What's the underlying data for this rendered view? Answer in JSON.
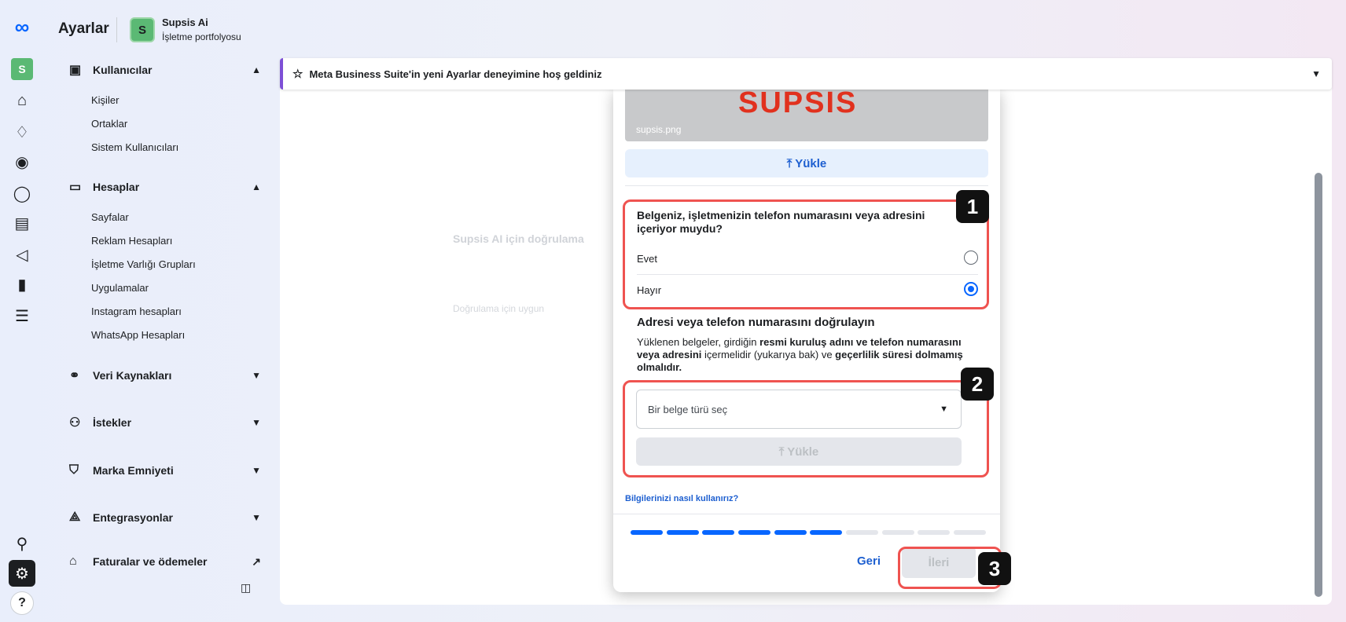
{
  "app": {
    "settings_title": "Ayarlar",
    "business_initial": "S",
    "business_name": "Supsis Ai",
    "business_type": "İşletme portfolyosu"
  },
  "rail": {
    "logo_glyph": "∞",
    "avatar_initial": "S",
    "help_glyph": "?"
  },
  "sidebar": {
    "users": {
      "label": "Kullanıcılar",
      "items": [
        "Kişiler",
        "Ortaklar",
        "Sistem Kullanıcıları"
      ]
    },
    "accounts": {
      "label": "Hesaplar",
      "items": [
        "Sayfalar",
        "Reklam Hesapları",
        "İşletme Varlığı Grupları",
        "Uygulamalar",
        "Instagram hesapları",
        "WhatsApp Hesapları"
      ]
    },
    "data_sources": "Veri Kaynakları",
    "requests": "İstekler",
    "brand_safety": "Marka Emniyeti",
    "integrations": "Entegrasyonlar",
    "billing": "Faturalar ve ödemeler"
  },
  "banner": {
    "text": "Meta Business Suite'in yeni Ayarlar deneyimine hoş geldiniz"
  },
  "background": {
    "verify_title": "Supsis AI için doğrulama",
    "eligible": "Doğrulama için uygun"
  },
  "modal": {
    "logo_fragment": "SUPSIS",
    "file_name": "supsis.png",
    "upload_label": "⤒ Yükle",
    "question": "Belgeniz, işletmenizin telefon numarasını veya adresini içeriyor muydu?",
    "option_yes": "Evet",
    "option_no": "Hayır",
    "selected": "Hayır",
    "verify_heading": "Adresi veya telefon numarasını doğrulayın",
    "desc_1": "Yüklenen belgeler, girdiğin ",
    "desc_b1": "resmi kuruluş adını ve telefon numarasını veya adresini",
    "desc_2": " içermelidir (yukarıya bak) ve ",
    "desc_b2": "geçerlilik süresi dolmamış olmalıdır.",
    "select_placeholder": "Bir belge türü seç",
    "upload2_label": "⤒ Yükle",
    "info_link": "Bilgilerinizi nasıl kullanırız?",
    "progress_total": 10,
    "progress_done": 6,
    "back_label": "Geri",
    "next_label": "İleri"
  },
  "annotations": [
    "1",
    "2",
    "3"
  ],
  "colors": {
    "accent": "#0866ff",
    "highlight": "#ef5350",
    "banner_border": "#7d4fd6",
    "brand_green": "#5bb974"
  }
}
